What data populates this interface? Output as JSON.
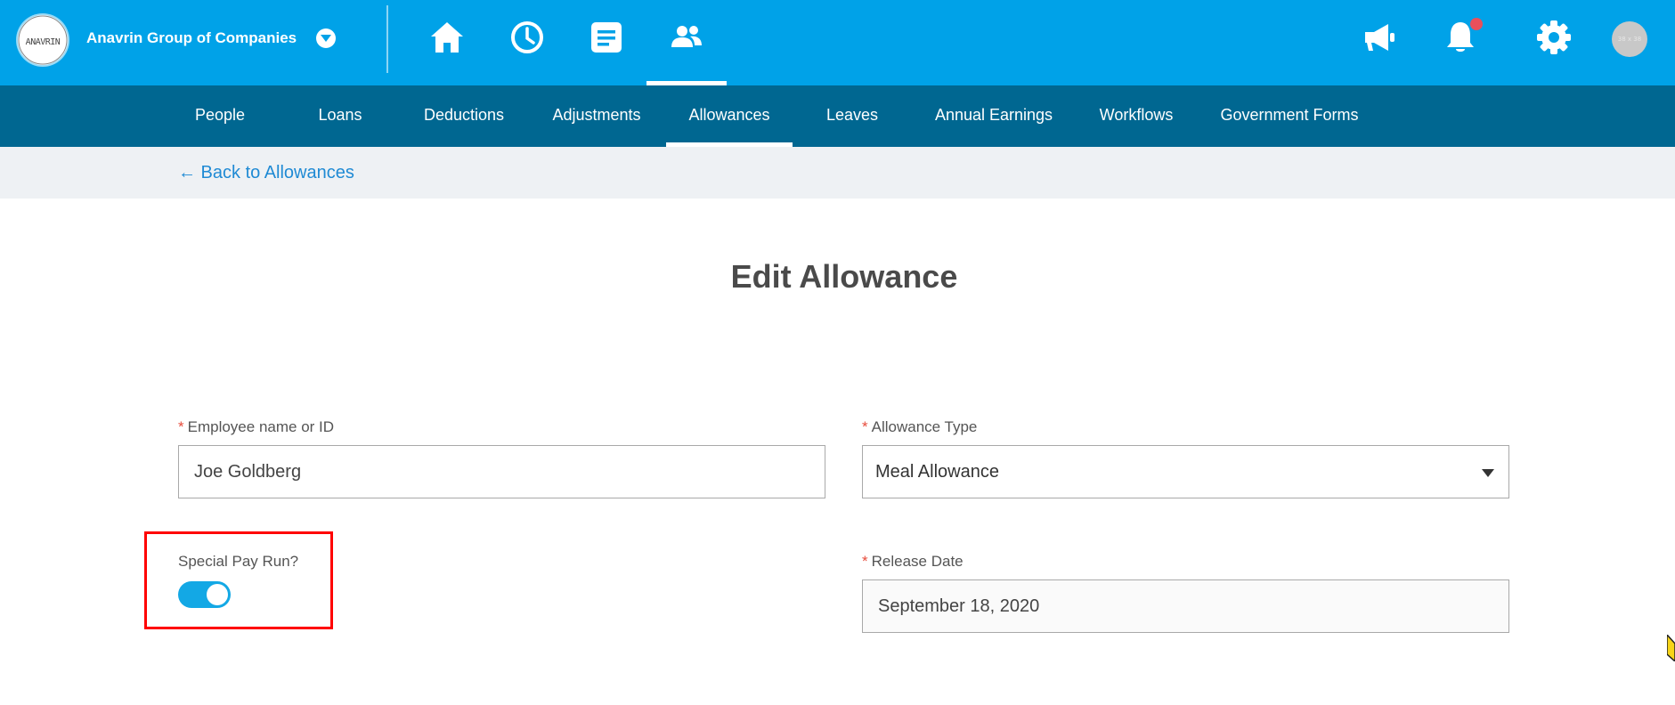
{
  "header": {
    "company_name": "Anavrin Group of Companies",
    "logo_text": "ANAVRIN",
    "avatar_text": "38 x 38",
    "nav_icons": [
      "home-icon",
      "clock-icon",
      "document-icon",
      "people-icon"
    ],
    "active_nav_icon": "people-icon",
    "right_icons": [
      "megaphone-icon",
      "bell-icon",
      "gear-icon"
    ],
    "has_notification": true
  },
  "subnav": {
    "items": [
      {
        "label": "People"
      },
      {
        "label": "Loans"
      },
      {
        "label": "Deductions"
      },
      {
        "label": "Adjustments"
      },
      {
        "label": "Allowances"
      },
      {
        "label": "Leaves"
      },
      {
        "label": "Annual Earnings"
      },
      {
        "label": "Workflows"
      },
      {
        "label": "Government Forms"
      }
    ],
    "active": "Allowances"
  },
  "breadcrumb": {
    "back_label": "← Back to Allowances"
  },
  "form": {
    "title": "Edit Allowance",
    "required_marker": "*",
    "employee": {
      "label": "Employee name or ID",
      "value": "Joe Goldberg",
      "required": true
    },
    "allowance_type": {
      "label": "Allowance Type",
      "value": "Meal Allowance",
      "required": true
    },
    "special_pay_run": {
      "label": "Special Pay Run?",
      "enabled": true
    },
    "release_date": {
      "label": "Release Date",
      "value": "September 18, 2020",
      "required": true
    }
  },
  "colors": {
    "topbar": "#00a2e8",
    "subnav": "#006791",
    "link": "#1f8ad4",
    "toggle_on": "#13a8e5",
    "required": "#e74c3c",
    "highlight": "#ff0000",
    "notification": "#e8505b"
  }
}
